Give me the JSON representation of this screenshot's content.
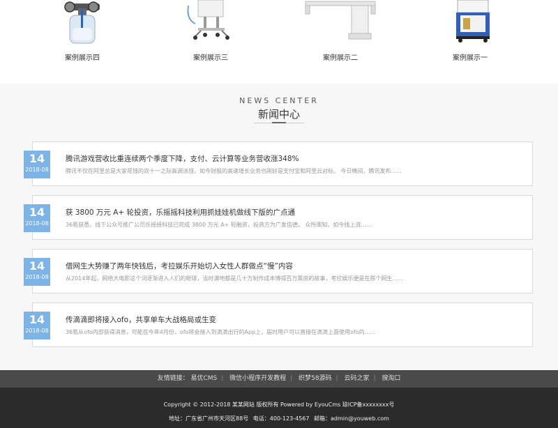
{
  "cases": [
    {
      "caption": "案例展示四"
    },
    {
      "caption": "案例展示三"
    },
    {
      "caption": "案例展示二"
    },
    {
      "caption": "案例展示一"
    }
  ],
  "news": {
    "heading_en": "NEWS CENTER",
    "heading_cn": "新闻中心",
    "items": [
      {
        "day": "14",
        "ym": "2018-08",
        "title": "腾讯游戏营收比重连续两个季度下降，支付、云计算等业务营收涨348%",
        "desc": "腾讯不仅在阿里总是大家花钱的双十一之际高调派钱，如今财报的高速增长业务也刚好是支付宝和阿里云对标。 今日晚间，腾讯发布......"
      },
      {
        "day": "14",
        "ym": "2018-08",
        "title": "获 3800 万元 A+ 轮投资，乐摇摇科技利用抓娃娃机做线下版的广点通",
        "desc": "36氪获悉，线下公众号推广公司乐摇摇科技已完成 3800 万元 A+ 轮融资，投资方为广发信德。 众所周知，如今线上流......"
      },
      {
        "day": "14",
        "ym": "2018-08",
        "title": "借网生大势赚了两年快钱后，考拉娱乐开始切入女性人群做点“慢”内容",
        "desc": "从2014年起，网络大电影这个词逐渐进入人们的眼球，当时满地都是几十万制作成本博得百万票房的故事，考拉娱乐便是在那个网生......"
      },
      {
        "day": "14",
        "ym": "2018-08",
        "title": "传滴滴即将接入ofo，共享单车大战格局或生变",
        "desc": "36氪从ofo内部获得消息，可能在今年4月份，ofo将会接入到滴滴出行的App上，届时用户可以直接在滴滴上面使用ofo的......"
      }
    ]
  },
  "footer": {
    "links_label": "友情链接：",
    "links": [
      "易优CMS",
      "微信小程序开发教程",
      "织梦58源码",
      "云码之家",
      "搜淘口"
    ],
    "copyright": "Copyright © 2012-2018 某某网站 版权所有 Powered by EyouCms 琼ICP备xxxxxxxx号",
    "address_label": "地址：广东省广州市天河区88号",
    "phone_label": "电话：400-123-4567",
    "email_label": "邮箱：admin@youweb.com"
  },
  "colors": {
    "date_badge": "#7db4e8",
    "links_bar": "#4a4a4a",
    "footer_bg": "#2b2b2b",
    "news_bg": "#f7f7f7"
  }
}
